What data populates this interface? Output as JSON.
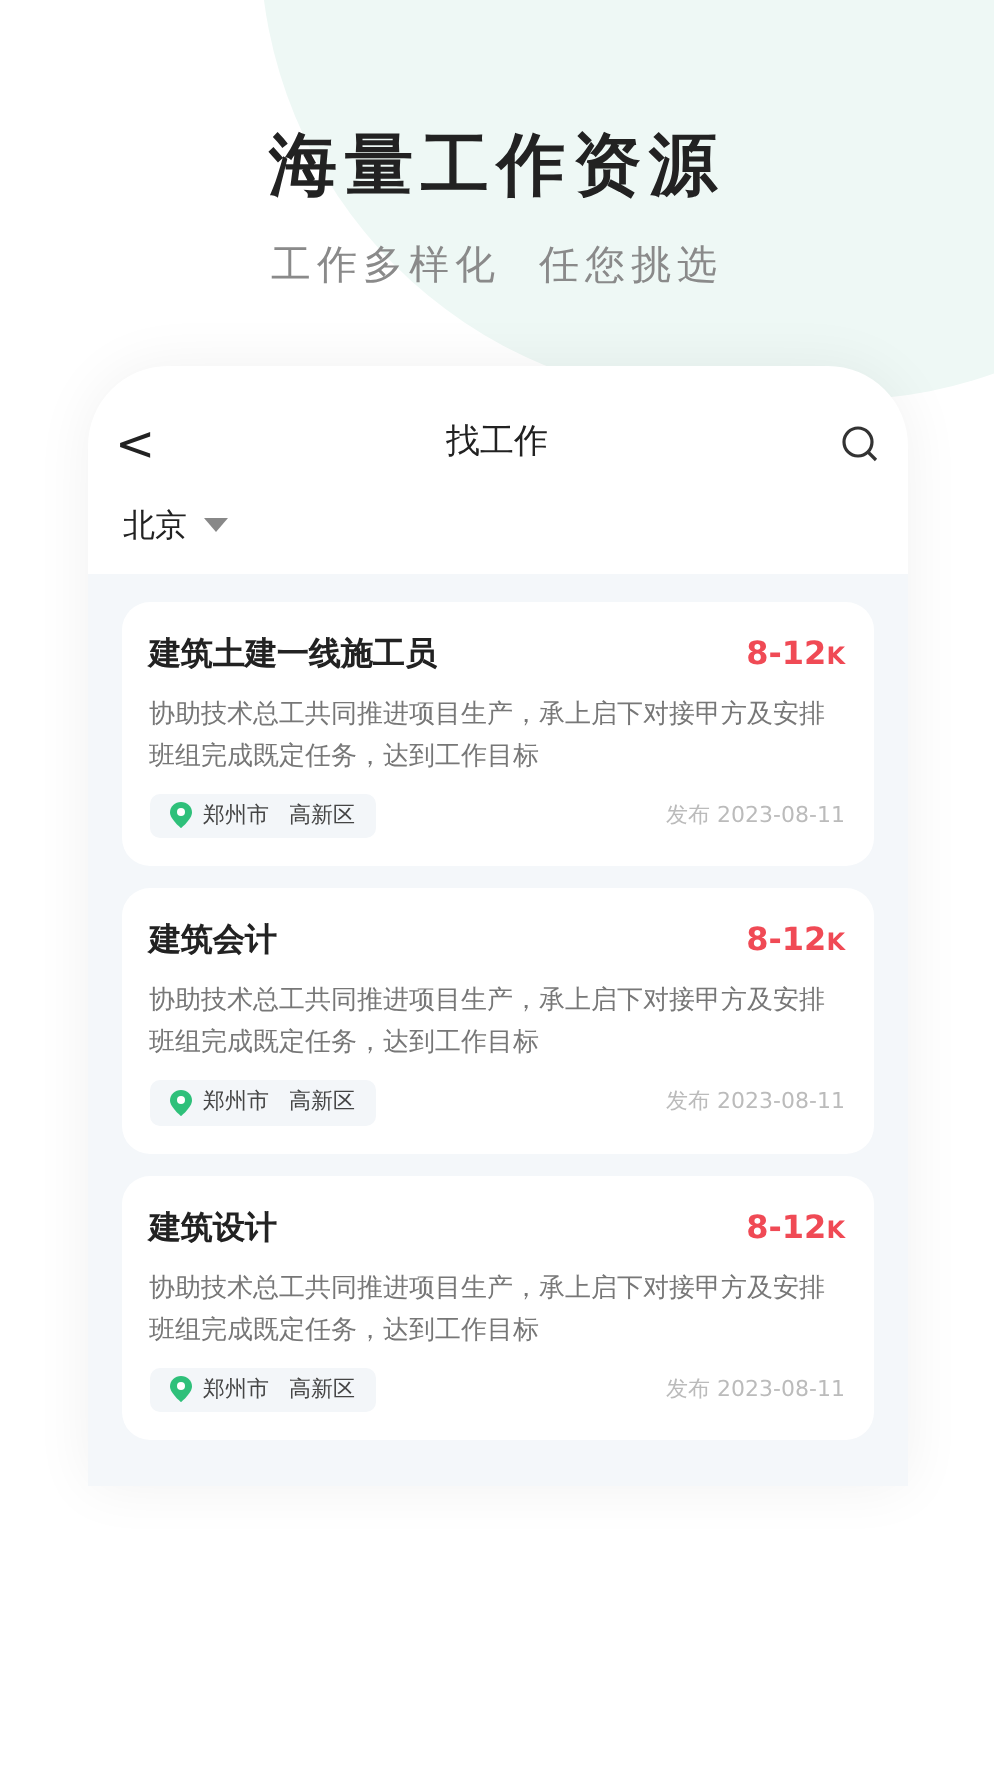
{
  "headline": "海量工作资源",
  "subtitle": "工作多样化  任您挑选",
  "app": {
    "back": "<",
    "title": "找工作",
    "city": "北京"
  },
  "jobs": [
    {
      "title": "建筑土建一线施工员",
      "salary": "8-12",
      "unit": "K",
      "description": "协助技术总工共同推进项目生产，承上启下对接甲方及安排班组完成既定任务，达到工作目标",
      "city": "郑州市",
      "district": "高新区",
      "published": "发布 2023-08-11"
    },
    {
      "title": "建筑会计",
      "salary": "8-12",
      "unit": "K",
      "description": "协助技术总工共同推进项目生产，承上启下对接甲方及安排班组完成既定任务，达到工作目标",
      "city": "郑州市",
      "district": "高新区",
      "published": "发布 2023-08-11"
    },
    {
      "title": "建筑设计",
      "salary": "8-12",
      "unit": "K",
      "description": "协助技术总工共同推进项目生产，承上启下对接甲方及安排班组完成既定任务，达到工作目标",
      "city": "郑州市",
      "district": "高新区",
      "published": "发布 2023-08-11"
    }
  ]
}
